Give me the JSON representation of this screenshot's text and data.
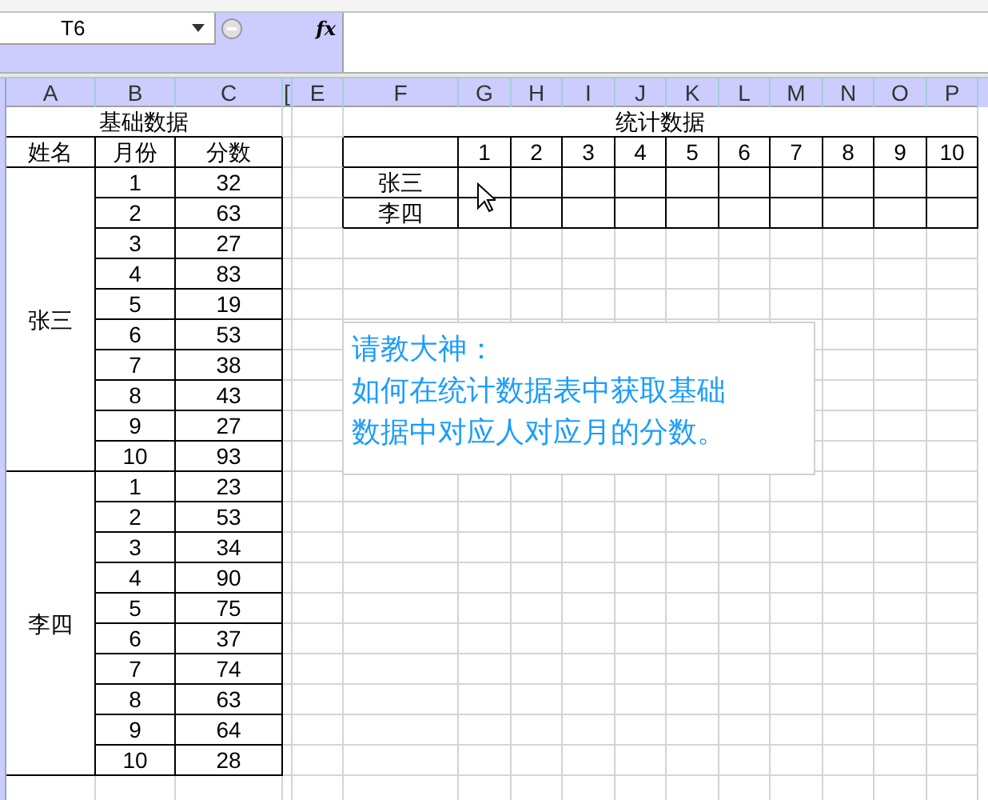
{
  "name_box": {
    "value": "T6"
  },
  "formula_bar": {
    "function_button": "fx"
  },
  "column_headers": [
    "A",
    "B",
    "C",
    "[",
    "E",
    "F",
    "G",
    "H",
    "I",
    "J",
    "K",
    "L",
    "M",
    "N",
    "O",
    "P"
  ],
  "base_table": {
    "title": "基础数据",
    "headers": [
      "姓名",
      "月份",
      "分数"
    ],
    "groups": [
      {
        "name": "张三",
        "rows": [
          [
            "1",
            "32"
          ],
          [
            "2",
            "63"
          ],
          [
            "3",
            "27"
          ],
          [
            "4",
            "83"
          ],
          [
            "5",
            "19"
          ],
          [
            "6",
            "53"
          ],
          [
            "7",
            "38"
          ],
          [
            "8",
            "43"
          ],
          [
            "9",
            "27"
          ],
          [
            "10",
            "93"
          ]
        ]
      },
      {
        "name": "李四",
        "rows": [
          [
            "1",
            "23"
          ],
          [
            "2",
            "53"
          ],
          [
            "3",
            "34"
          ],
          [
            "4",
            "90"
          ],
          [
            "5",
            "75"
          ],
          [
            "6",
            "37"
          ],
          [
            "7",
            "74"
          ],
          [
            "8",
            "63"
          ],
          [
            "9",
            "64"
          ],
          [
            "10",
            "28"
          ]
        ]
      }
    ]
  },
  "stats_table": {
    "title": "统计数据",
    "months": [
      "1",
      "2",
      "3",
      "4",
      "5",
      "6",
      "7",
      "8",
      "9",
      "10"
    ],
    "names": [
      "张三",
      "李四"
    ]
  },
  "note": {
    "lines": [
      "请教大神：",
      "如何在统计数据表中获取基础",
      "数据中对应人对应月的分数。"
    ]
  }
}
